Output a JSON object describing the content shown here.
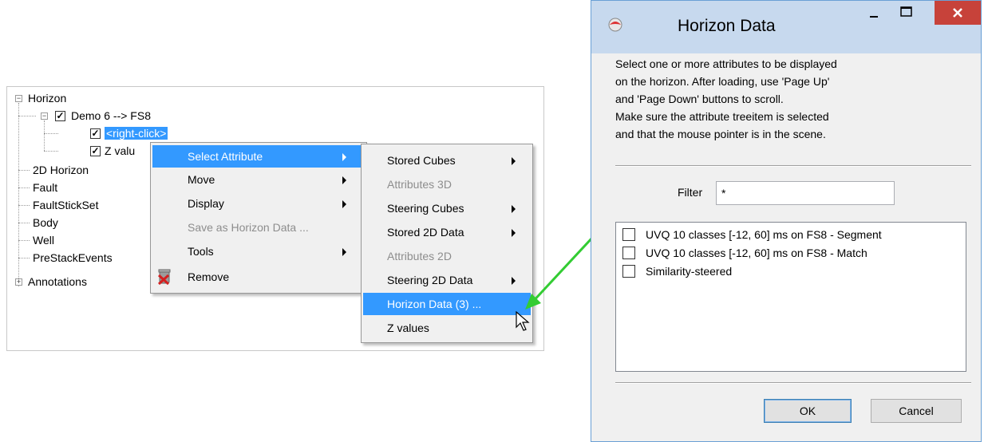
{
  "tree": {
    "root_label": "Horizon",
    "child_label": "Demo 6 --> FS8",
    "selected_item": "<right-click>",
    "z_item": "Z valu",
    "items": [
      "2D Horizon",
      "Fault",
      "FaultStickSet",
      "Body",
      "Well",
      "PreStackEvents",
      "Annotations"
    ]
  },
  "context_menu": {
    "items": [
      {
        "label": "Select Attribute",
        "submenu": true,
        "enabled": true
      },
      {
        "label": "Move",
        "submenu": true,
        "enabled": true
      },
      {
        "label": "Display",
        "submenu": true,
        "enabled": true
      },
      {
        "label": "Save as Horizon Data ...",
        "submenu": false,
        "enabled": false
      },
      {
        "label": "Tools",
        "submenu": true,
        "enabled": true
      },
      {
        "label": "Remove",
        "submenu": false,
        "enabled": true,
        "icon": "remove-icon"
      }
    ]
  },
  "submenu": {
    "items": [
      {
        "label": "Stored Cubes",
        "submenu": true,
        "enabled": true
      },
      {
        "label": "Attributes 3D",
        "submenu": false,
        "enabled": false
      },
      {
        "label": "Steering Cubes",
        "submenu": true,
        "enabled": true
      },
      {
        "label": "Stored 2D Data",
        "submenu": true,
        "enabled": true
      },
      {
        "label": "Attributes 2D",
        "submenu": false,
        "enabled": false
      },
      {
        "label": "Steering 2D Data",
        "submenu": true,
        "enabled": true
      },
      {
        "label": "Horizon Data (3) ...",
        "submenu": false,
        "enabled": true
      },
      {
        "label": "Z values",
        "submenu": false,
        "enabled": true
      }
    ]
  },
  "dialog": {
    "title": "Horizon Data",
    "info_lines": [
      "Select one or more attributes to be displayed",
      "on the horizon. After loading, use 'Page Up'",
      "and 'Page Down' buttons to scroll.",
      "Make sure the attribute treeitem is selected",
      "and that the mouse pointer is in the scene."
    ],
    "filter_label": "Filter",
    "filter_value": "*",
    "attributes": [
      "UVQ 10 classes [-12, 60] ms on FS8  - Segment",
      "UVQ 10 classes [-12, 60] ms on FS8 - Match",
      "Similarity-steered"
    ],
    "ok_label": "OK",
    "cancel_label": "Cancel"
  },
  "colors": {
    "selection": "#3399ff",
    "arrow": "#33cc33",
    "close_button": "#c7423a",
    "titlebar": "#c7d9ee"
  }
}
